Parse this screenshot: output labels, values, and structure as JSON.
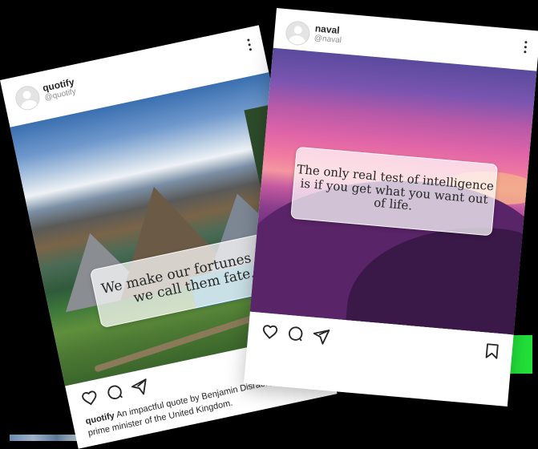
{
  "posts": [
    {
      "user": {
        "name": "quotify",
        "handle": "@quotify"
      },
      "quote": "We make our fortunes and we call them fate.",
      "caption": {
        "author": "quotify",
        "text": "An impactful quote by Benjamin Disraeli, a former prime minister of the United Kingdom."
      },
      "actions": [
        "heart-icon",
        "comment-icon",
        "share-icon"
      ]
    },
    {
      "user": {
        "name": "naval",
        "handle": "@naval"
      },
      "quote": "The only real test of intelligence is if you get what you want out of life.",
      "actions": [
        "heart-icon",
        "comment-icon",
        "share-icon",
        "bookmark-icon"
      ]
    }
  ],
  "colors": {
    "background": "#000000",
    "accent_green": "#22e03a",
    "text": "#262626",
    "muted": "#8e8e8e"
  }
}
